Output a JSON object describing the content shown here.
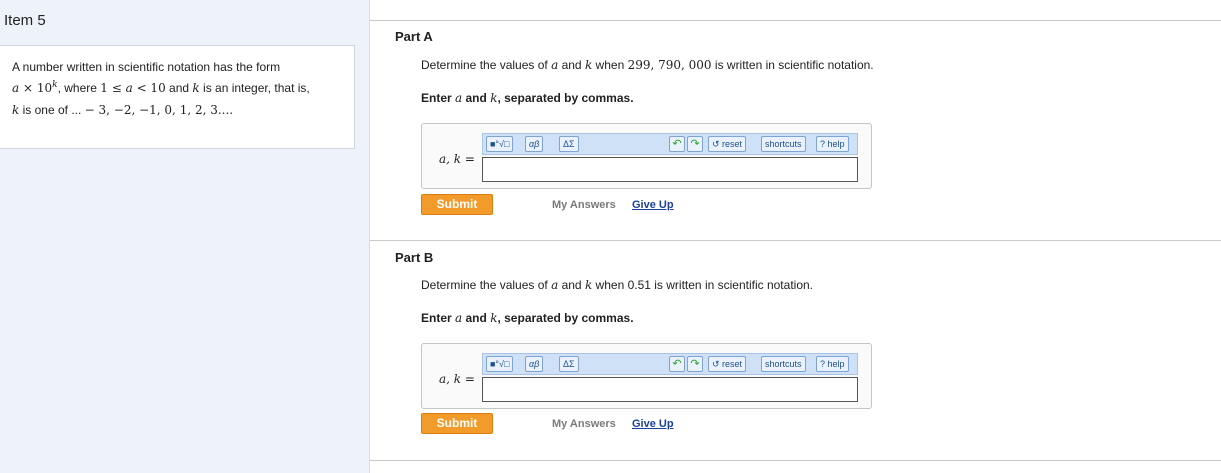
{
  "left_panel": {
    "item_title": "Item 5",
    "line1": "A number written in scientific notation has the form",
    "line2_a": "a",
    "line2_times": " × 10",
    "line2_k": "k",
    "line2_where": ", where ",
    "line2_ineq": "1 ≤ ",
    "line2_ineq_a": "a",
    "line2_ineq2": " < 10",
    "line2_and": " and ",
    "line2_k2": "k",
    "line2_rest": " is an integer, that is,",
    "line3_k": "k",
    "line3_text": " is one of ... ",
    "line3_seq": "− 3, −2, −1, 0, 1, 2, 3...."
  },
  "part_a": {
    "title": "Part A",
    "prompt_pre": "Determine the values of ",
    "a": "a",
    "and": " and ",
    "k": "k",
    "when": " when ",
    "number": "299, 790, 000",
    "post": " is written in scientific notation.",
    "enter_pre": "Enter ",
    "enter_and": " and ",
    "enter_post": ", separated by commas."
  },
  "part_b": {
    "title": "Part B",
    "prompt_pre": "Determine the values of ",
    "a": "a",
    "and": " and ",
    "k": "k",
    "post": " when 0.51 is written in scientific notation.",
    "enter_pre": "Enter ",
    "enter_and": " and ",
    "enter_post": ", separated by commas."
  },
  "answer": {
    "label": "a, k =",
    "tb_templates": "■°√□",
    "tb_greek": "αβ",
    "tb_symbols": "ΔΣ",
    "undo_icon": "↶",
    "redo_icon": "↷",
    "reset": "↺ reset",
    "shortcuts": "shortcuts",
    "help": "? help",
    "value": ""
  },
  "actions": {
    "submit": "Submit",
    "my_answers": "My Answers",
    "give_up": "Give Up"
  }
}
